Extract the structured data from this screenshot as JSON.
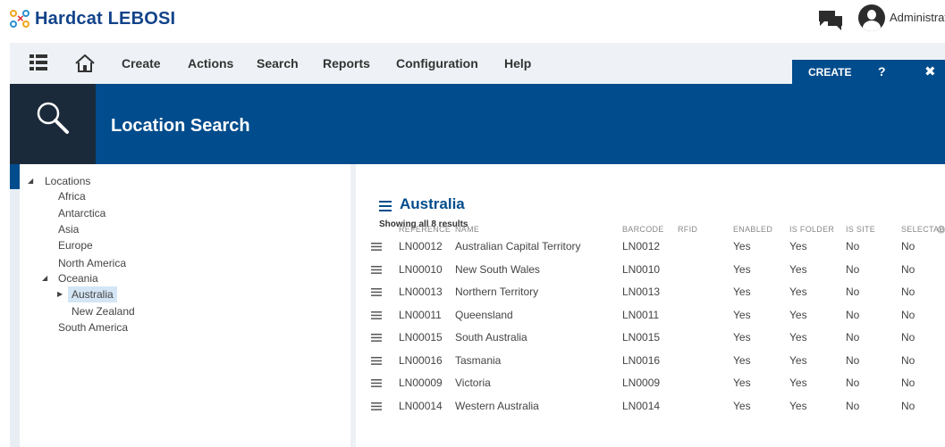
{
  "brand": {
    "name": "Hardcat LEBOSI"
  },
  "header": {
    "user_name": "Administrat"
  },
  "menu": {
    "items": [
      "Create",
      "Actions",
      "Search",
      "Reports",
      "Configuration",
      "Help"
    ]
  },
  "create_panel": {
    "label": "CREATE",
    "help": "?",
    "close": "✖"
  },
  "page": {
    "title": "Location Search"
  },
  "tree": {
    "root": "Locations",
    "children": [
      "Africa",
      "Antarctica",
      "Asia",
      "Europe",
      "North America",
      "Oceania",
      "South America"
    ],
    "oceania_children": [
      "Australia",
      "New Zealand"
    ],
    "selected": "Australia"
  },
  "results": {
    "title": "Australia",
    "count_text": "Showing all 8 results",
    "columns": [
      "REFERENCE",
      "NAME",
      "BARCODE",
      "RFID",
      "ENABLED",
      "IS FOLDER",
      "IS SITE",
      "SELECTAB..."
    ],
    "rows": [
      [
        "LN00012",
        "Australian Capital Territory",
        "LN0012",
        "",
        "Yes",
        "Yes",
        "No",
        "No"
      ],
      [
        "LN00010",
        "New South Wales",
        "LN0010",
        "",
        "Yes",
        "Yes",
        "No",
        "No"
      ],
      [
        "LN00013",
        "Northern Territory",
        "LN0013",
        "",
        "Yes",
        "Yes",
        "No",
        "No"
      ],
      [
        "LN00011",
        "Queensland",
        "LN0011",
        "",
        "Yes",
        "Yes",
        "No",
        "No"
      ],
      [
        "LN00015",
        "South Australia",
        "LN0015",
        "",
        "Yes",
        "Yes",
        "No",
        "No"
      ],
      [
        "LN00016",
        "Tasmania",
        "LN0016",
        "",
        "Yes",
        "Yes",
        "No",
        "No"
      ],
      [
        "LN00009",
        "Victoria",
        "LN0009",
        "",
        "Yes",
        "Yes",
        "No",
        "No"
      ],
      [
        "LN00014",
        "Western Australia",
        "LN0014",
        "",
        "Yes",
        "Yes",
        "No",
        "No"
      ]
    ]
  },
  "colors": {
    "brand_blue": "#014c8c",
    "dark_box": "#1b2a3a",
    "menu_bg": "#eef2f6",
    "selected_bg": "#d4e6f5"
  },
  "icons": {
    "menu_grid": "grid-menu-icon",
    "home": "home-icon",
    "chat": "chat-icon",
    "user": "user-icon",
    "search": "search-icon",
    "list": "list-icon",
    "row_handle": "drag-handle-icon",
    "settings": "gear-icon"
  }
}
